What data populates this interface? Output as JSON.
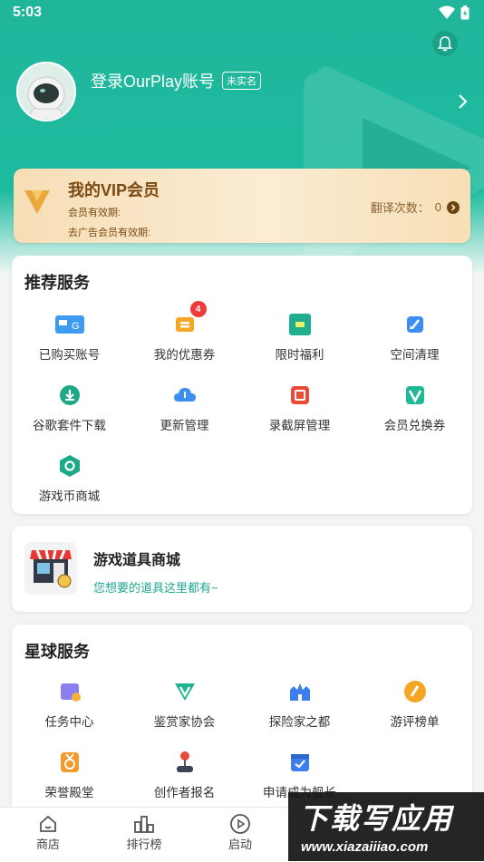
{
  "status_bar": {
    "time": "5:03"
  },
  "profile": {
    "login_text": "登录OurPlay账号",
    "realname_badge": "未实名"
  },
  "vip": {
    "title": "我的VIP会员",
    "validity": "会员有效期:",
    "ad_free_validity": "去广告会员有效期:",
    "translate_label": "翻译次数：",
    "translate_count": "0"
  },
  "recommended": {
    "title": "推荐服务",
    "items": [
      {
        "label": "已购买账号",
        "icon": "account-icon"
      },
      {
        "label": "我的优惠券",
        "icon": "coupon-icon",
        "badge": "4"
      },
      {
        "label": "限时福利",
        "icon": "welfare-icon"
      },
      {
        "label": "空间清理",
        "icon": "broom-icon"
      },
      {
        "label": "谷歌套件下载",
        "icon": "download-icon"
      },
      {
        "label": "更新管理",
        "icon": "cloud-icon"
      },
      {
        "label": "录截屏管理",
        "icon": "record-icon"
      },
      {
        "label": "会员兑换券",
        "icon": "vip-voucher-icon"
      },
      {
        "label": "游戏币商城",
        "icon": "coin-icon"
      }
    ]
  },
  "shop": {
    "title": "游戏道具商城",
    "subtitle": "您想要的道具这里都有~"
  },
  "planet": {
    "title": "星球服务",
    "items": [
      {
        "label": "任务中心",
        "icon": "task-icon"
      },
      {
        "label": "鉴赏家协会",
        "icon": "connoisseur-icon"
      },
      {
        "label": "探险家之都",
        "icon": "castle-icon"
      },
      {
        "label": "游评榜单",
        "icon": "review-icon"
      },
      {
        "label": "荣誉殿堂",
        "icon": "medal-icon"
      },
      {
        "label": "创作者报名",
        "icon": "joystick-icon"
      },
      {
        "label": "申请成为舰长",
        "icon": "captain-icon"
      }
    ]
  },
  "tabbar": {
    "tabs": [
      {
        "label": "商店"
      },
      {
        "label": "排行榜"
      },
      {
        "label": "启动"
      }
    ]
  },
  "watermark": {
    "main": "下载写应用",
    "sub": "www.xiazaiiiao.com"
  }
}
